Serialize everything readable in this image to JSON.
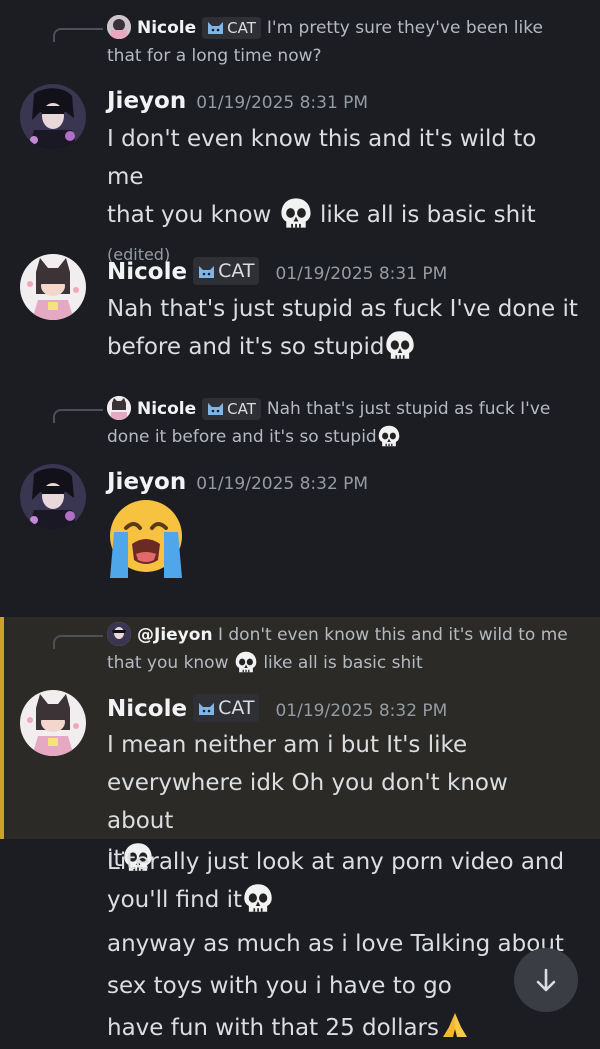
{
  "messages": {
    "reply1": {
      "name": "Nicole",
      "tag": "CAT",
      "text_line1": "I'm pretty sure they've been like",
      "text_line2": "that for a long time now?"
    },
    "msg1": {
      "name": "Jieyon",
      "time": "01/19/2025 8:31 PM",
      "line1": "I don't even know this and it's wild to me",
      "line2a": "that you know",
      "line2b": "like all is basic shit",
      "edited": "(edited)"
    },
    "msg2": {
      "name": "Nicole",
      "tag": "CAT",
      "time": "01/19/2025 8:31 PM",
      "line1": "Nah that's just stupid as fuck I've done it",
      "line2": "before and it's so stupid"
    },
    "reply2": {
      "name": "Nicole",
      "tag": "CAT",
      "text_line1": "Nah that's just stupid as fuck I've",
      "text_line2": "done it before and it's so stupid"
    },
    "msg3": {
      "name": "Jieyon",
      "time": "01/19/2025 8:32 PM",
      "emoji": "loudly-crying-face"
    },
    "reply3": {
      "mention": "@Jieyon",
      "text_line1": "I don't even know this and it's wild to me",
      "text_line2a": "that you know",
      "text_line2b": "like all is basic shit"
    },
    "msg4": {
      "name": "Nicole",
      "tag": "CAT",
      "time": "01/19/2025 8:32 PM",
      "line1": "I mean neither am i but It's like",
      "line2": "everywhere idk Oh you don't know about",
      "line3": "it"
    },
    "msg5": {
      "line1": "Literally just look at any porn video and",
      "line2": "you'll find it"
    },
    "msg6": {
      "line1": "anyway as much as i love Talking about",
      "line2": "sex toys with you i have to go",
      "line3": "have fun with that 25 dollars"
    }
  },
  "colors": {
    "background": "#1c1d22",
    "highlight": "#2b2a26",
    "highlight_bar": "#c9a227"
  },
  "icons": [
    "skull-emoji",
    "cat-icon",
    "loudly-crying-face-emoji",
    "folded-hands-emoji",
    "arrow-down-icon"
  ]
}
